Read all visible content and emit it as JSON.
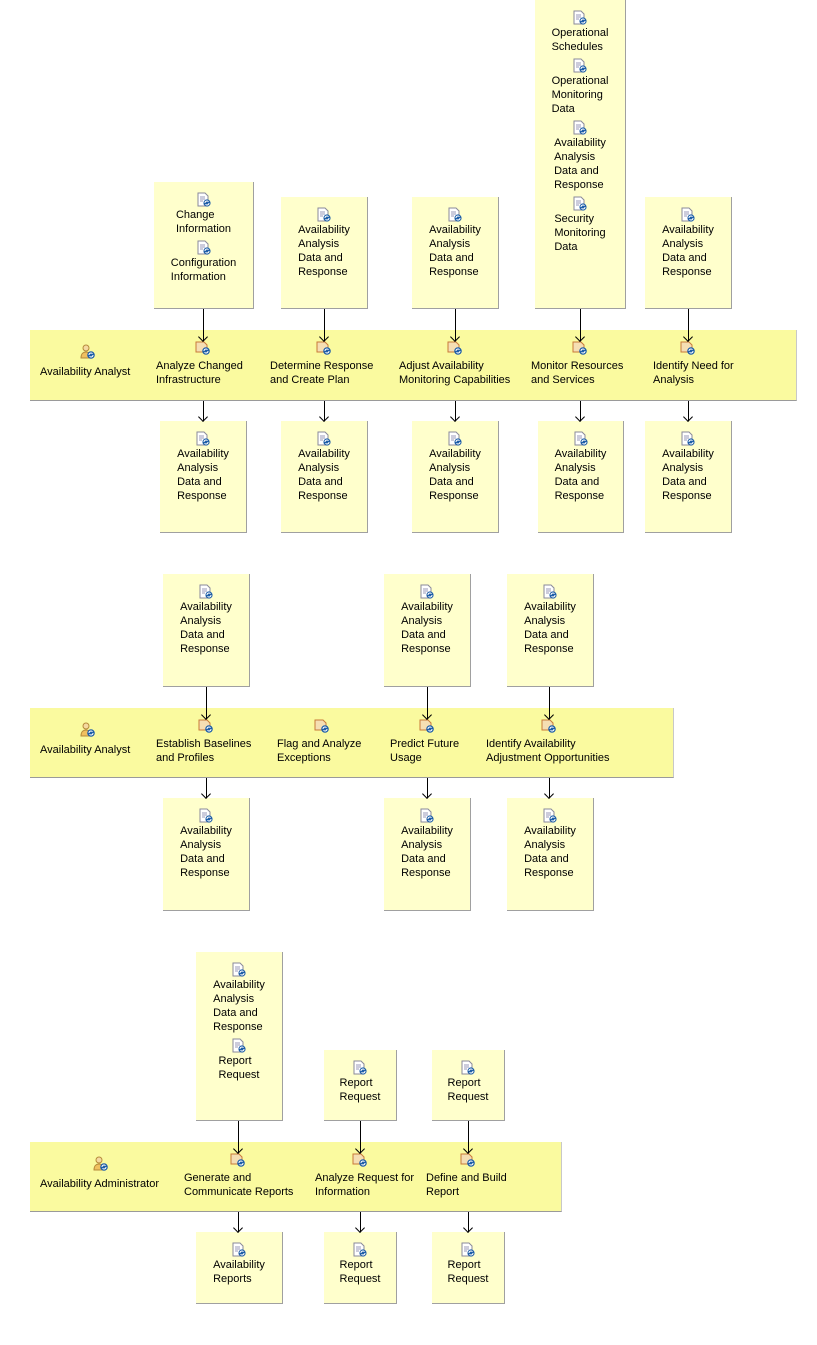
{
  "colors": {
    "artifact_box": "#ffffcc",
    "lane": "#fafa9f",
    "arrow": "#000000"
  },
  "sections": [
    {
      "role": "Availability Analyst",
      "role_icon": "role-icon",
      "tasks": [
        {
          "label": "Analyze Changed Infrastructure",
          "inputs": [
            "Change Information",
            "Configuration Information"
          ],
          "outputs": [
            "Availability Analysis Data and Response"
          ]
        },
        {
          "label": "Determine Response and Create Plan",
          "inputs": [
            "Availability Analysis Data and Response"
          ],
          "outputs": [
            "Availability Analysis Data and Response"
          ]
        },
        {
          "label": "Adjust Availability Monitoring Capabilities",
          "inputs": [
            "Availability Analysis Data and Response"
          ],
          "outputs": [
            "Availability Analysis Data and Response"
          ]
        },
        {
          "label": "Monitor Resources and Services",
          "inputs": [
            "Operational Schedules",
            "Operational Monitoring Data",
            "Availability Analysis Data and Response",
            "Security Monitoring Data"
          ],
          "outputs": [
            "Availability Analysis Data and Response"
          ]
        },
        {
          "label": "Identify Need for Analysis",
          "inputs": [
            "Availability Analysis Data and Response"
          ],
          "outputs": [
            "Availability Analysis Data and Response"
          ]
        }
      ]
    },
    {
      "role": "Availability Analyst",
      "role_icon": "role-icon",
      "tasks": [
        {
          "label": "Establish Baselines and Profiles",
          "inputs": [
            "Availability Analysis Data and Response"
          ],
          "outputs": [
            "Availability Analysis Data and Response"
          ]
        },
        {
          "label": "Flag and Analyze Exceptions",
          "inputs": [],
          "outputs": []
        },
        {
          "label": "Predict Future Usage",
          "inputs": [
            "Availability Analysis Data and Response"
          ],
          "outputs": [
            "Availability Analysis Data and Response"
          ]
        },
        {
          "label": "Identify Availability Adjustment Opportunities",
          "inputs": [
            "Availability Analysis Data and Response"
          ],
          "outputs": [
            "Availability Analysis Data and Response"
          ]
        }
      ]
    },
    {
      "role": "Availability Administrator",
      "role_icon": "role-icon",
      "tasks": [
        {
          "label": "Generate and Communicate Reports",
          "inputs": [
            "Availability Analysis Data and Response",
            "Report Request"
          ],
          "outputs": [
            "Availability Reports"
          ]
        },
        {
          "label": "Analyze Request for Information",
          "inputs": [
            "Report Request"
          ],
          "outputs": [
            "Report Request"
          ]
        },
        {
          "label": "Define and Build Report",
          "inputs": [
            "Report Request"
          ],
          "outputs": [
            "Report Request"
          ]
        }
      ]
    }
  ]
}
